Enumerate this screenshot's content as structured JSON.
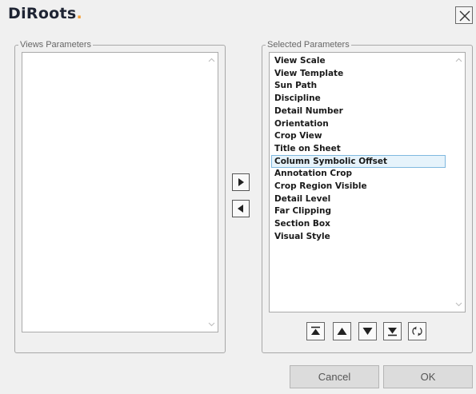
{
  "header": {
    "logo_text": "DiRoots",
    "logo_dot": ".",
    "logo_accent_color": "#f2a03a",
    "close_icon": "close-icon"
  },
  "views_parameters": {
    "title": "Views Parameters",
    "items": []
  },
  "transfer": {
    "add_icon": "triangle-right-icon",
    "remove_icon": "triangle-left-icon"
  },
  "selected_parameters": {
    "title": "Selected Parameters",
    "selected_item": "Column Symbolic Offset",
    "items": [
      "View Scale",
      "View Template",
      "Sun Path",
      "Discipline",
      "Detail Number",
      "Orientation",
      "Crop View",
      "Title on Sheet",
      "Column Symbolic Offset",
      "Annotation Crop",
      "Crop Region Visible",
      "Detail Level",
      "Far Clipping",
      "Section Box",
      "Visual Style"
    ]
  },
  "order_controls": {
    "move_top_icon": "move-to-top-icon",
    "move_up_icon": "move-up-icon",
    "move_down_icon": "move-down-icon",
    "move_bottom_icon": "move-to-bottom-icon",
    "reset_icon": "refresh-icon"
  },
  "footer": {
    "cancel_label": "Cancel",
    "ok_label": "OK"
  }
}
